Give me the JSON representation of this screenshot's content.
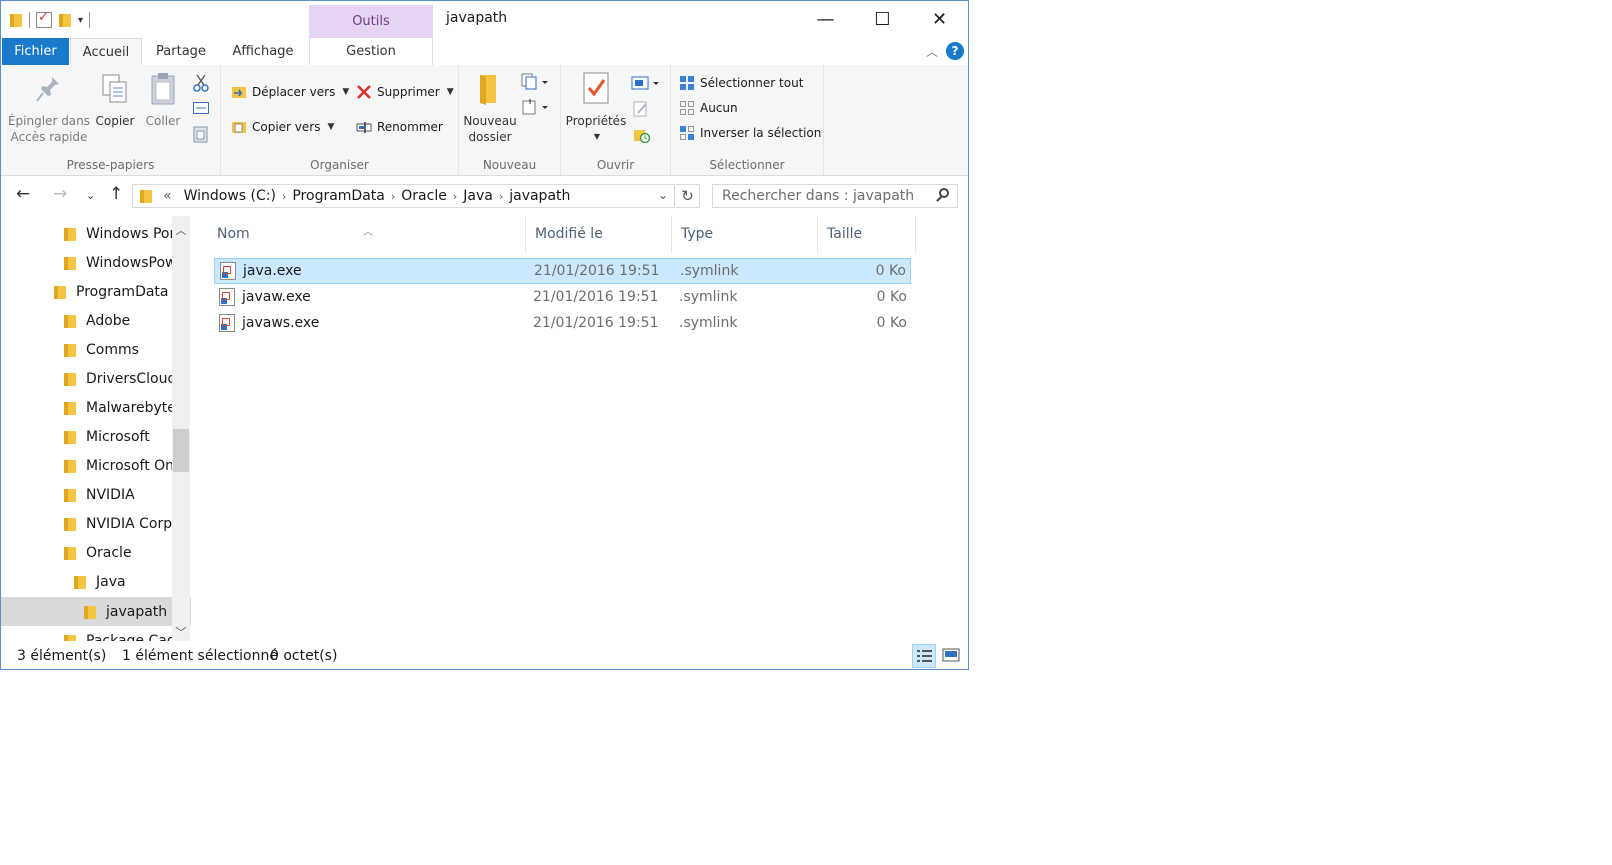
{
  "window": {
    "title": "javapath",
    "contextual_tab_group": "Outils d'application",
    "controls": {
      "minimize": "—",
      "maximize": "☐",
      "close": "✕"
    }
  },
  "ribbon_tabs": [
    {
      "label": "Fichier"
    },
    {
      "label": "Accueil"
    },
    {
      "label": "Partage"
    },
    {
      "label": "Affichage"
    },
    {
      "label": "Gestion"
    }
  ],
  "ribbon": {
    "clipboard": {
      "label": "Presse-papiers",
      "pin_line1": "Épingler dans",
      "pin_line2": "Accès rapide",
      "copy": "Copier",
      "paste": "Coller"
    },
    "organize": {
      "label": "Organiser",
      "move_to": "Déplacer vers",
      "copy_to": "Copier vers",
      "delete": "Supprimer",
      "rename": "Renommer"
    },
    "new": {
      "label": "Nouveau",
      "new_folder_line1": "Nouveau",
      "new_folder_line2": "dossier"
    },
    "open": {
      "label": "Ouvrir",
      "properties": "Propriétés"
    },
    "select": {
      "label": "Sélectionner",
      "select_all": "Sélectionner tout",
      "select_none": "Aucun",
      "invert": "Inverser la sélection"
    }
  },
  "address": {
    "prefix": "«",
    "segments": [
      "Windows (C:)",
      "ProgramData",
      "Oracle",
      "Java",
      "javapath"
    ],
    "search_placeholder": "Rechercher dans : javapath"
  },
  "nav_tree": [
    {
      "label": "Windows Port",
      "indent": 1
    },
    {
      "label": "WindowsPow",
      "indent": 1
    },
    {
      "label": "ProgramData",
      "indent": 0
    },
    {
      "label": "Adobe",
      "indent": 1
    },
    {
      "label": "Comms",
      "indent": 1
    },
    {
      "label": "DriversCloud.",
      "indent": 1
    },
    {
      "label": "Malwarebytes",
      "indent": 1
    },
    {
      "label": "Microsoft",
      "indent": 1
    },
    {
      "label": "Microsoft One",
      "indent": 1
    },
    {
      "label": "NVIDIA",
      "indent": 1
    },
    {
      "label": "NVIDIA Corpo",
      "indent": 1
    },
    {
      "label": "Oracle",
      "indent": 1
    },
    {
      "label": "Java",
      "indent": 2
    },
    {
      "label": "javapath",
      "indent": 3,
      "selected": true
    },
    {
      "label": "Package Cach",
      "indent": 1
    }
  ],
  "columns": [
    "Nom",
    "Modifié le",
    "Type",
    "Taille"
  ],
  "files": [
    {
      "name": "java.exe",
      "modified": "21/01/2016 19:51",
      "type": ".symlink",
      "size": "0 Ko",
      "selected": true
    },
    {
      "name": "javaw.exe",
      "modified": "21/01/2016 19:51",
      "type": ".symlink",
      "size": "0 Ko",
      "selected": false
    },
    {
      "name": "javaws.exe",
      "modified": "21/01/2016 19:51",
      "type": ".symlink",
      "size": "0 Ko",
      "selected": false
    }
  ],
  "status": {
    "count": "3 élément(s)",
    "selection": "1 élément sélectionné",
    "size": "0 octet(s)"
  },
  "colors": {
    "accent": "#1979ca",
    "selection": "#cce8ff",
    "contextual": "#e7d3f2"
  }
}
